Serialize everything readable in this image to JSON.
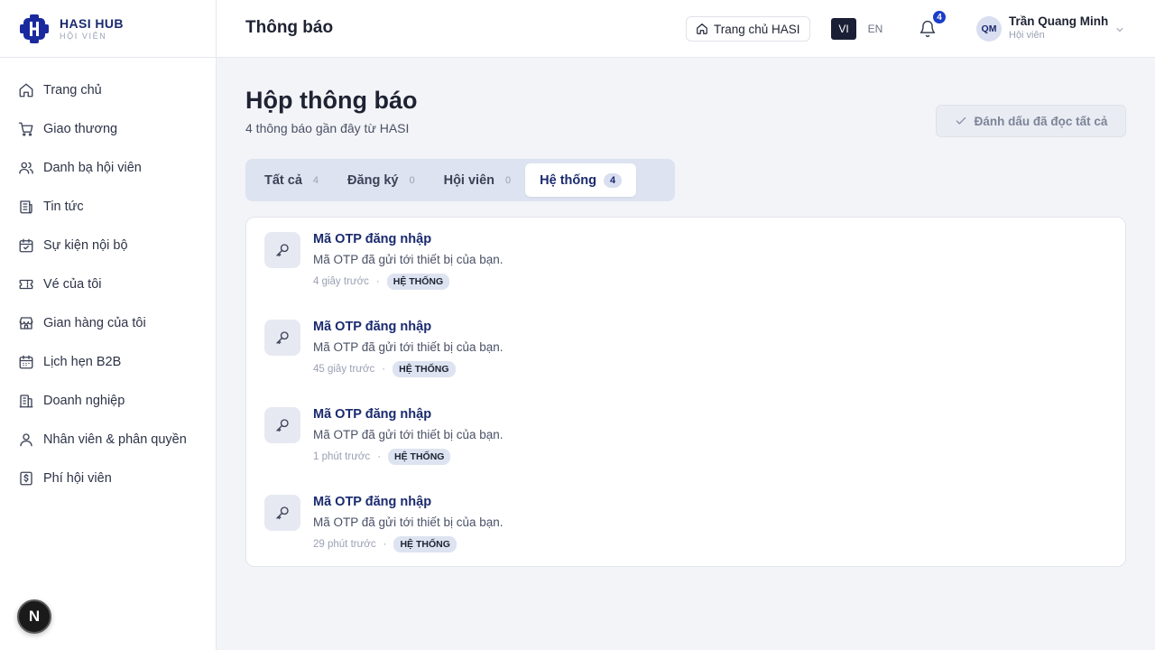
{
  "brand": {
    "name": "HASI HUB",
    "subtitle": "HỘI VIÊN"
  },
  "sidebar": {
    "items": [
      {
        "label": "Trang chủ",
        "icon": "home-icon"
      },
      {
        "label": "Giao thương",
        "icon": "cart-icon"
      },
      {
        "label": "Danh bạ hội viên",
        "icon": "users-icon"
      },
      {
        "label": "Tin tức",
        "icon": "newspaper-icon"
      },
      {
        "label": "Sự kiện nội bộ",
        "icon": "calendar-check-icon"
      },
      {
        "label": "Vé của tôi",
        "icon": "ticket-icon"
      },
      {
        "label": "Gian hàng của tôi",
        "icon": "store-icon"
      },
      {
        "label": "Lịch hẹn B2B",
        "icon": "calendar-icon"
      },
      {
        "label": "Doanh nghiệp",
        "icon": "building-icon"
      },
      {
        "label": "Nhân viên & phân quyền",
        "icon": "user-icon"
      },
      {
        "label": "Phí hội viên",
        "icon": "receipt-icon"
      }
    ],
    "fab_label": "N"
  },
  "header": {
    "title": "Thông báo",
    "home_button": "Trang chủ HASI",
    "lang_vi": "VI",
    "lang_en": "EN",
    "notification_count": "4",
    "user": {
      "initials": "QM",
      "name": "Trần Quang Minh",
      "role": "Hội viên"
    }
  },
  "main": {
    "heading": "Hộp thông báo",
    "subtitle": "4 thông báo gần đây từ HASI",
    "mark_all_read": "Đánh dấu đã đọc tất cả",
    "tabs": [
      {
        "label": "Tất cả",
        "count": "4",
        "active": false
      },
      {
        "label": "Đăng ký",
        "count": "0",
        "active": false
      },
      {
        "label": "Hội viên",
        "count": "0",
        "active": false
      },
      {
        "label": "Hệ thống",
        "count": "4",
        "active": true
      }
    ],
    "notifications": [
      {
        "title": "Mã OTP đăng nhập",
        "body": "Mã OTP đã gửi tới thiết bị của bạn.",
        "time": "4 giây trước",
        "tag": "HỆ THỐNG",
        "icon": "key-icon"
      },
      {
        "title": "Mã OTP đăng nhập",
        "body": "Mã OTP đã gửi tới thiết bị của bạn.",
        "time": "45 giây trước",
        "tag": "HỆ THỐNG",
        "icon": "key-icon"
      },
      {
        "title": "Mã OTP đăng nhập",
        "body": "Mã OTP đã gửi tới thiết bị của bạn.",
        "time": "1 phút trước",
        "tag": "HỆ THỐNG",
        "icon": "key-icon"
      },
      {
        "title": "Mã OTP đăng nhập",
        "body": "Mã OTP đã gửi tới thiết bị của bạn.",
        "time": "29 phút trước",
        "tag": "HỆ THỐNG",
        "icon": "key-icon"
      }
    ]
  },
  "colors": {
    "brand": "#1a2a6e",
    "accent": "#1a3ec7",
    "tab_bg": "#dde3f0"
  }
}
